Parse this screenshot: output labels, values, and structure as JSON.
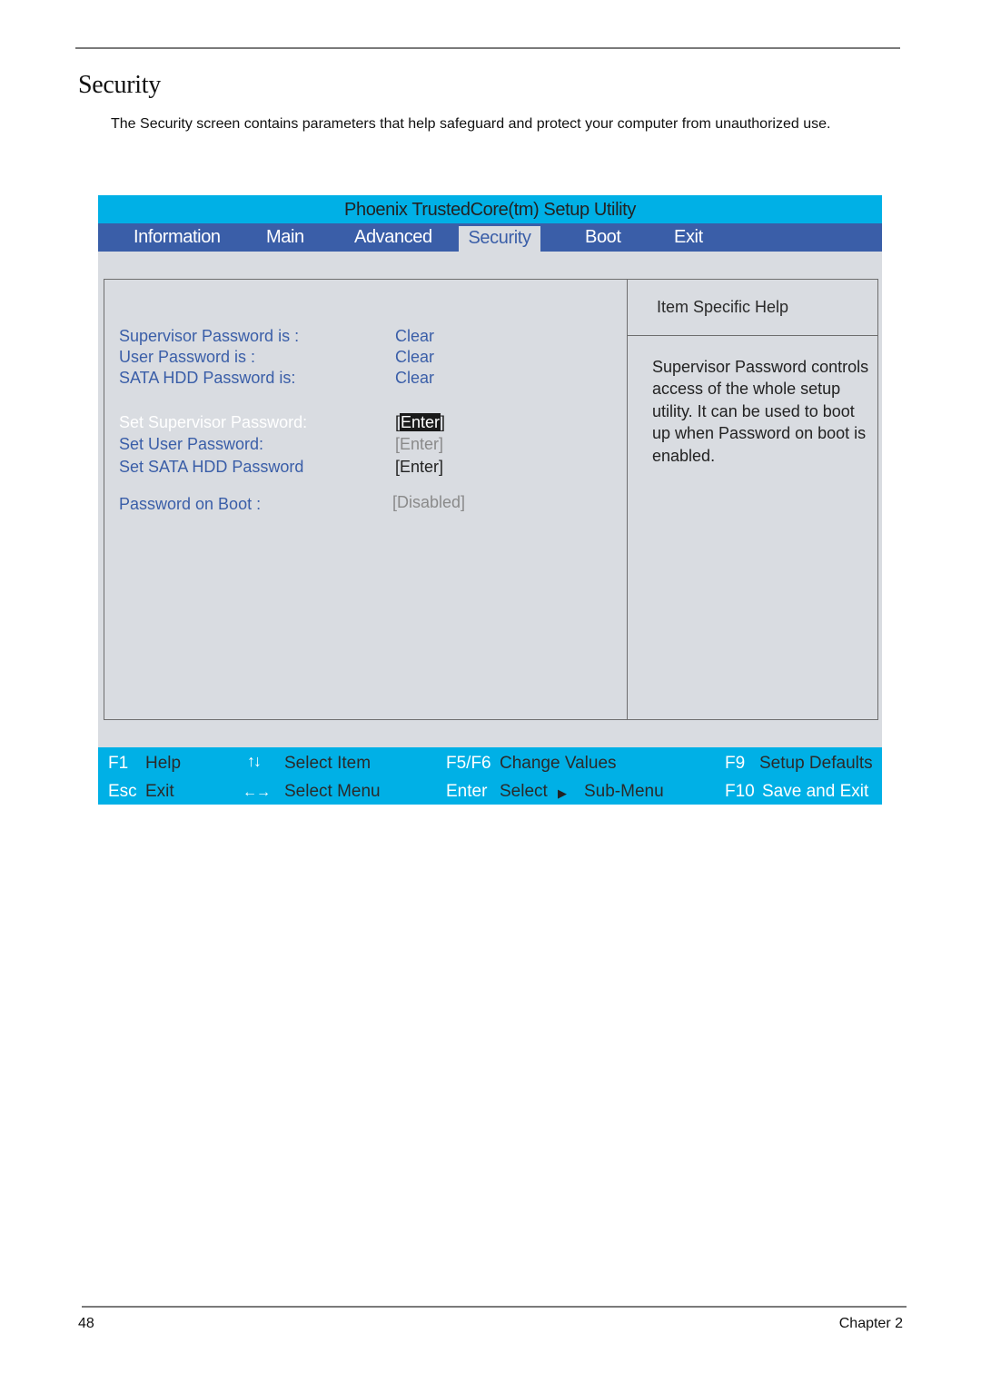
{
  "document": {
    "section_title": "Security",
    "intro": "The Security screen contains parameters that help safeguard and protect your computer from unauthorized use.",
    "page_number": "48",
    "chapter": "Chapter 2"
  },
  "bios": {
    "title": "Phoenix TrustedCore(tm) Setup Utility",
    "tabs": [
      {
        "label": "Information",
        "active": false
      },
      {
        "label": "Main",
        "active": false
      },
      {
        "label": "Advanced",
        "active": false
      },
      {
        "label": "Security",
        "active": true
      },
      {
        "label": "Boot",
        "active": false
      },
      {
        "label": "Exit",
        "active": false
      }
    ],
    "items": [
      {
        "label": "Supervisor Password is :",
        "value": "Clear"
      },
      {
        "label": "User Password is :",
        "value": "Clear"
      },
      {
        "label": "SATA HDD Password is:",
        "value": "Clear"
      },
      {
        "label": "Set Supervisor Password:",
        "value_prefix": "[",
        "value": "Enter",
        "value_suffix": "]",
        "selected": true
      },
      {
        "label": "Set User Password:",
        "value": "[Enter]"
      },
      {
        "label": "Set SATA HDD Password",
        "value": "[Enter]"
      },
      {
        "label": "Password on Boot :",
        "value": "[Disabled]"
      }
    ],
    "help": {
      "title": "Item Specific Help",
      "text": "Supervisor Password controls access of the whole setup utility. It can be used to boot up when Password on boot is enabled."
    },
    "statusbar": {
      "f1_key": "F1",
      "f1_desc": "Help",
      "esc_key": "Esc",
      "esc_desc": "Exit",
      "updown_icon": "↑↓",
      "updown_desc": "Select Item",
      "leftright_icon": "←→",
      "leftright_desc": "Select Menu",
      "f5f6_key": "F5/F6",
      "f5f6_desc": "Change Values",
      "enter_key": "Enter",
      "enter_desc": "Select",
      "submenu_icon": "▶",
      "submenu_desc": "Sub-Menu",
      "f9_key": "F9",
      "f9_desc": "Setup Defaults",
      "f10_key": "F10",
      "f10_desc": "Save and Exit"
    },
    "colors": {
      "title_bar": "#00b0e6",
      "menu_bar": "#3a5ea8",
      "panel_bg": "#d9dce1",
      "item_label": "#3a5ea8"
    }
  }
}
